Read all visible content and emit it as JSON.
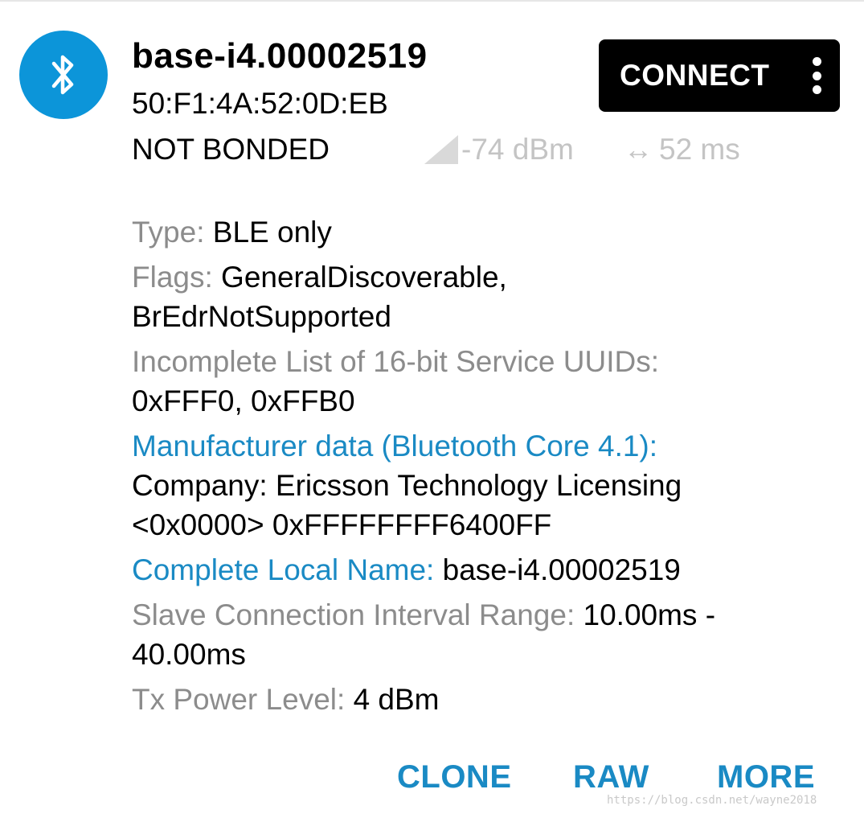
{
  "device": {
    "name": "base-i4.00002519",
    "mac": "50:F1:4A:52:0D:EB",
    "bond_state": "NOT BONDED",
    "rssi": "-74 dBm",
    "interval": "52 ms",
    "icon": "bluetooth-icon"
  },
  "header_actions": {
    "connect_label": "CONNECT",
    "menu_icon": "more-vert-icon"
  },
  "details": {
    "type": {
      "label": "Type:",
      "value": "BLE only"
    },
    "flags": {
      "label": "Flags:",
      "value_line1": "GeneralDiscoverable,",
      "value_line2": "BrEdrNotSupported"
    },
    "uuids": {
      "label": "Incomplete List of 16-bit Service UUIDs:",
      "value": "0xFFF0, 0xFFB0"
    },
    "manufacturer": {
      "label": "Manufacturer data (Bluetooth Core 4.1):",
      "line1": "Company: Ericsson Technology Licensing",
      "line2": "<0x0000> 0xFFFFFFFF6400FF"
    },
    "local_name": {
      "label": "Complete Local Name:",
      "value": "base-i4.00002519"
    },
    "slave_interval": {
      "label": "Slave Connection Interval Range:",
      "value_line1": "10.00ms -",
      "value_line2": "40.00ms"
    },
    "tx_power": {
      "label": "Tx Power Level:",
      "value": "4 dBm"
    }
  },
  "footer_actions": {
    "clone": "CLONE",
    "raw": "RAW",
    "more": "MORE"
  },
  "watermark": "https://blog.csdn.net/wayne2018",
  "colors": {
    "accent": "#1a8ac4",
    "avatar_bg": "#0c95d9",
    "muted_label": "#8c8c8c",
    "signal_gray": "#c4c4c4",
    "button_bg": "#000000"
  }
}
